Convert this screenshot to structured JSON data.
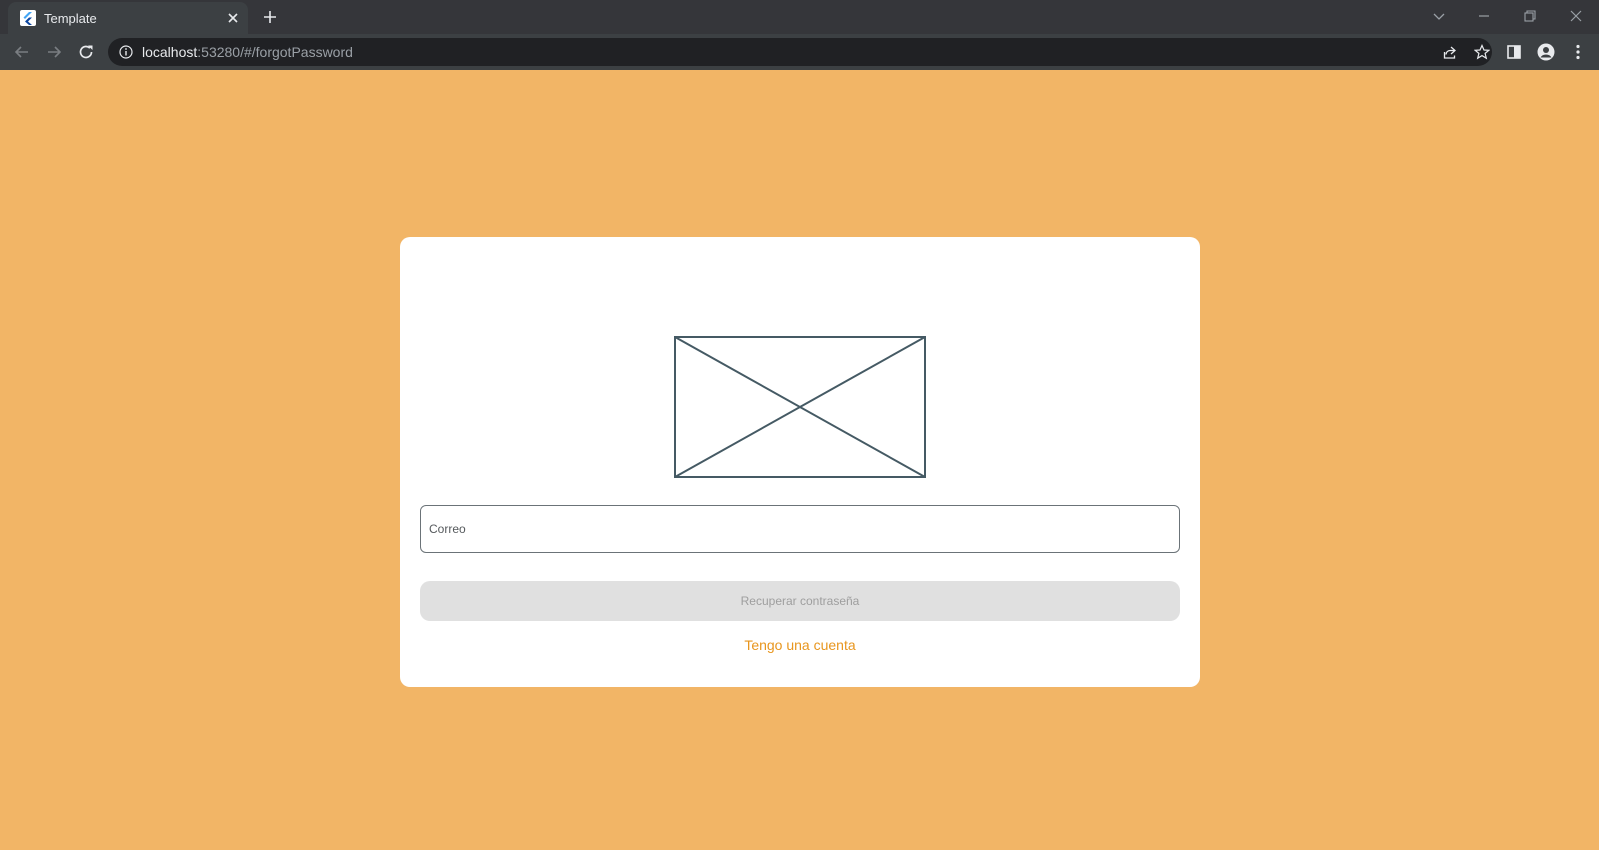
{
  "browser": {
    "tab": {
      "title": "Template",
      "favicon": "flutter-logo-icon"
    },
    "address_bar": {
      "host": "localhost",
      "rest": ":53280/#/forgotPassword"
    },
    "icons": {
      "back": "back-arrow-icon",
      "forward": "forward-arrow-icon",
      "reload": "reload-icon",
      "site_info": "info-icon",
      "share": "share-icon",
      "bookmark": "star-icon",
      "side_panel": "side-panel-icon",
      "profile": "profile-icon",
      "menu": "kebab-menu-icon",
      "tab_search": "chevron-down-icon",
      "minimize": "minimize-icon",
      "restore": "restore-icon",
      "close": "close-icon"
    }
  },
  "page": {
    "background_color": "#f2b566",
    "card": {
      "image": "image-placeholder-icon",
      "email_field": {
        "placeholder": "Correo",
        "value": ""
      },
      "recover_button": {
        "label": "Recuperar contraseña",
        "enabled": false
      },
      "login_link": {
        "label": "Tengo una cuenta",
        "color": "#e8961e"
      }
    }
  }
}
